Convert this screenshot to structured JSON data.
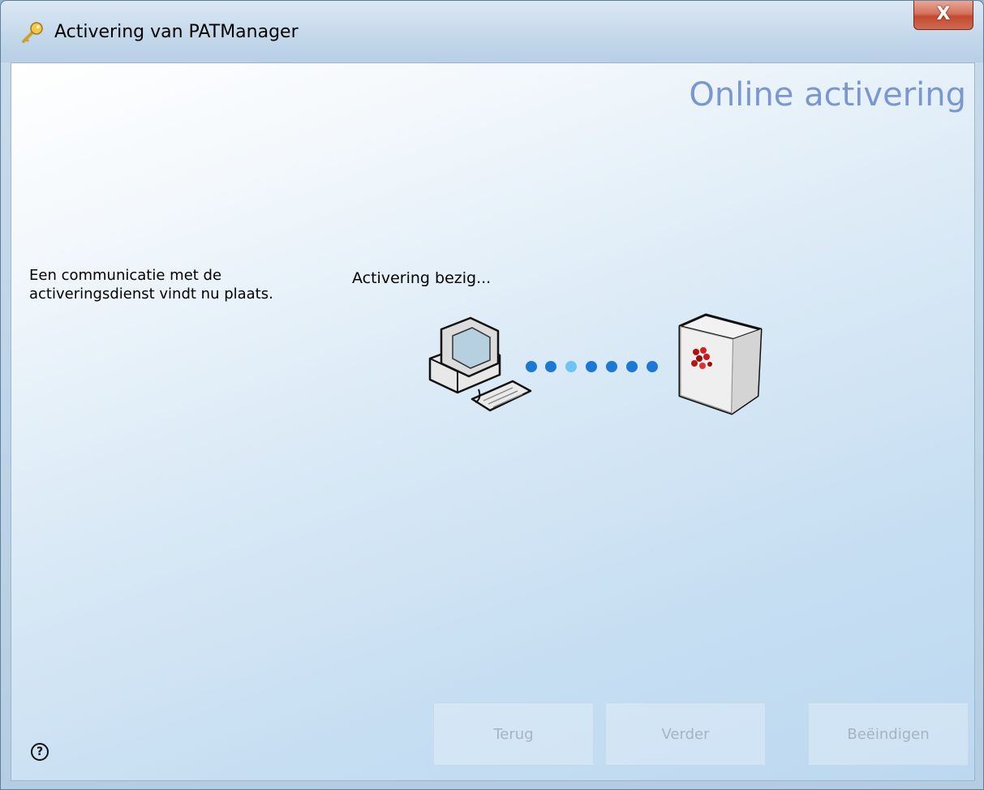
{
  "window": {
    "title": "Activering van PATManager",
    "close_label": "X"
  },
  "main": {
    "heading": "Online activering",
    "description_line1": "Een communicatie met de",
    "description_line2": "activeringsdienst vindt nu plaats.",
    "status": "Activering bezig..."
  },
  "footer": {
    "help_label": "?",
    "back_label": "Terug",
    "next_label": "Verder",
    "finish_label": "Beëindigen"
  },
  "icons": {
    "title": "key-icon",
    "computer": "computer-icon",
    "server": "server-icon",
    "help": "help-icon"
  },
  "progress": {
    "dot_count": 7,
    "active_dot": 3
  },
  "colors": {
    "heading": "#7b97cf",
    "dot": "#1b79d3",
    "dot_active": "#6fc3f6",
    "close_button": "#c24a30"
  }
}
